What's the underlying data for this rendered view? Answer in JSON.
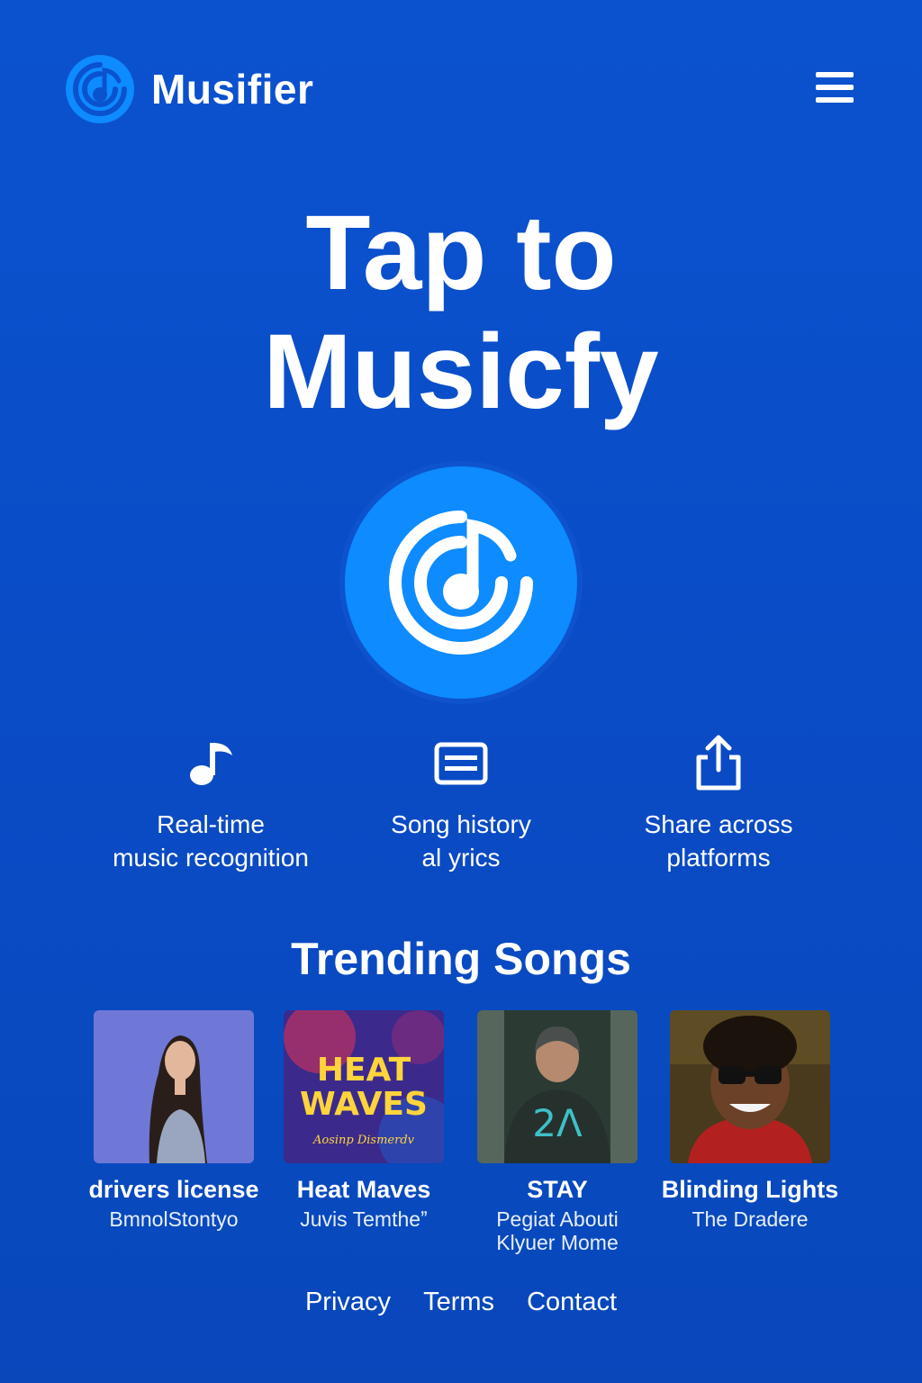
{
  "header": {
    "brand": "Musifier",
    "logo_icon": "musifier-logo-icon",
    "menu_icon": "hamburger-menu-icon"
  },
  "hero": {
    "line1": "Tap to",
    "line2": "Musicfy"
  },
  "main_button": {
    "icon": "musifier-listen-icon"
  },
  "features": [
    {
      "icon": "music-note-icon",
      "line1": "Real-time",
      "line2": "music recognition"
    },
    {
      "icon": "lyrics-list-icon",
      "line1": "Song history",
      "line2": "al yrics"
    },
    {
      "icon": "share-icon",
      "line1": "Share across",
      "line2": "platforms"
    }
  ],
  "trending": {
    "title": "Trending Songs",
    "songs": [
      {
        "title": "drivers license",
        "artist_line1": "BmnolStontyo",
        "artist_line2": ""
      },
      {
        "title": "Heat Maves",
        "artist_line1": "Juvis Temtheˮ",
        "artist_line2": "",
        "cover_text1": "HEAT",
        "cover_text2": "WAVES",
        "cover_text3": "Aosinp Dismerdv"
      },
      {
        "title": "STAY",
        "artist_line1": "Pegiat Abouti",
        "artist_line2": "Klyuer Mome",
        "cover_text1": "2Λ"
      },
      {
        "title": "Blinding Lights",
        "artist_line1": "The Dradere",
        "artist_line2": ""
      }
    ]
  },
  "footer": {
    "links": [
      "Privacy",
      "Terms",
      "Contact"
    ]
  },
  "colors": {
    "background": "#0b52cf",
    "accent": "#0d8bff",
    "text": "#ffffff"
  }
}
